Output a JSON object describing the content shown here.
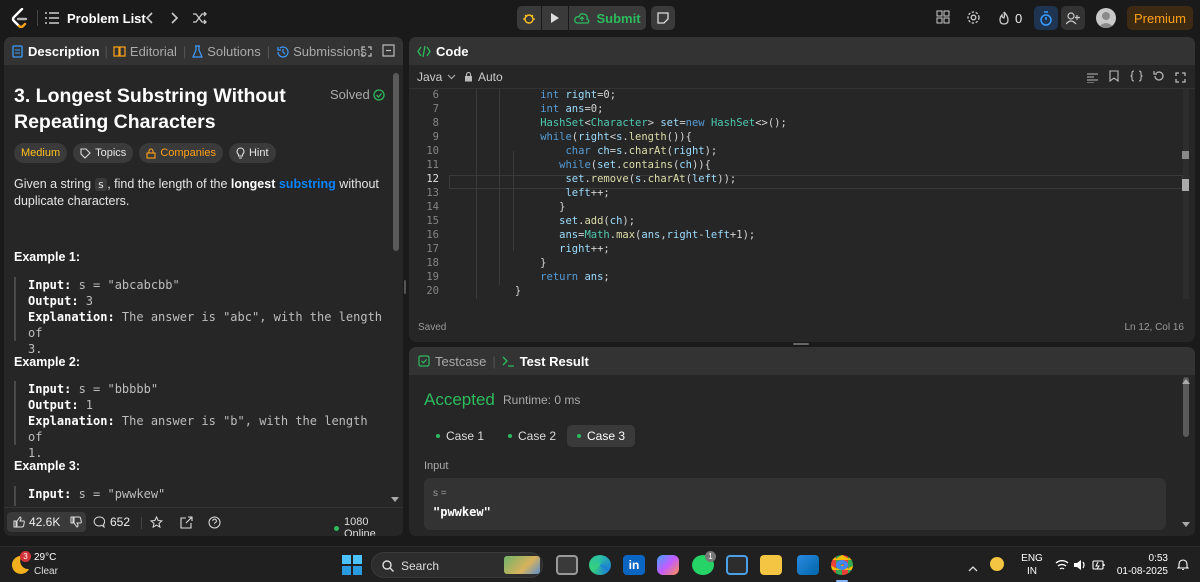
{
  "topbar": {
    "problem_list": "Problem List",
    "submit": "Submit",
    "streak_count": "0",
    "premium": "Premium"
  },
  "left": {
    "tabs": [
      "Description",
      "Editorial",
      "Solutions",
      "Submissions"
    ],
    "title_line1": "3. Longest Substring Without",
    "title_line2": "Repeating Characters",
    "solved": "Solved",
    "pills": [
      "Medium",
      "Topics",
      "Companies",
      "Hint"
    ],
    "desc_a": "Given a string ",
    "desc_code": "s",
    "desc_b": ", find the length of the ",
    "desc_bold": "longest",
    "desc_link": "substring",
    "desc_c": " without",
    "desc_d": "duplicate characters.",
    "ex1_title": "Example 1:",
    "ex2_title": "Example 2:",
    "ex3_title": "Example 3:",
    "label_input": "Input:",
    "label_output": "Output:",
    "label_expl": "Explanation:",
    "ex1_input": " s = \"abcabcbb\"",
    "ex1_output": " 3",
    "ex1_expl_1": " The answer is \"abc\", with the length of",
    "ex1_expl_2": "3.",
    "ex2_input": " s = \"bbbbb\"",
    "ex2_output": " 1",
    "ex2_expl_1": " The answer is \"b\", with the length of",
    "ex2_expl_2": "1.",
    "ex3_input": " s = \"pwwkew\"",
    "likes": "42.6K",
    "comments": "652",
    "online": "1080 Online"
  },
  "code": {
    "tab_title": "Code",
    "language": "Java",
    "auto": "Auto",
    "saved": "Saved",
    "cursor": "Ln 12, Col 16",
    "line_numbers": [
      "6",
      "7",
      "8",
      "9",
      "10",
      "11",
      "12",
      "13",
      "14",
      "15",
      "16",
      "17",
      "18",
      "19",
      "20"
    ]
  },
  "test": {
    "tab_testcase": "Testcase",
    "tab_result": "Test Result",
    "status": "Accepted",
    "runtime": "Runtime: 0 ms",
    "cases": [
      "Case 1",
      "Case 2",
      "Case 3"
    ],
    "input_label": "Input",
    "var_label": "s =",
    "var_value": "\"pwwkew\""
  },
  "taskbar": {
    "weather_badge": "3",
    "temp": "29°C",
    "weather": "Clear",
    "search": "Search",
    "notif_badge": "1",
    "lang1": "ENG",
    "lang2": "IN",
    "time": "0:53",
    "date": "01-08-2025"
  },
  "colors": {
    "accepted": "#2cbb5d",
    "medium": "#ffc01e",
    "premium": "#ffa116",
    "link": "#0a84ff",
    "submit": "#2cbb5d"
  }
}
